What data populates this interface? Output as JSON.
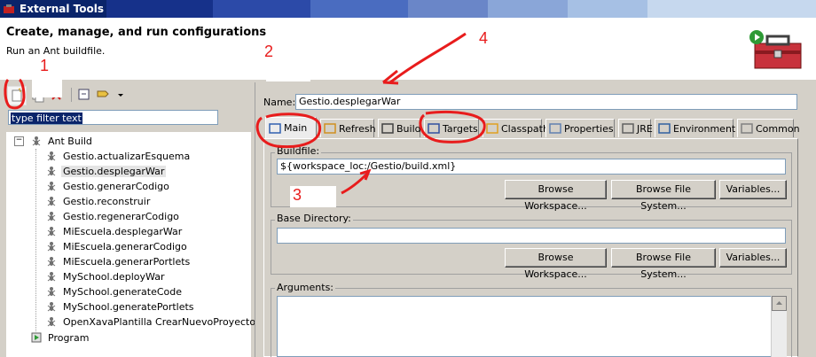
{
  "window": {
    "title": "External Tools",
    "title_gradient": [
      "#0a246a",
      "#16318a",
      "#2c4aa8",
      "#4a6cc0",
      "#6a86c8",
      "#8aa6d8",
      "#a6c0e4",
      "#c6d8ee"
    ]
  },
  "header": {
    "title": "Create, manage, and run configurations",
    "subtitle": "Run an Ant buildfile."
  },
  "left": {
    "filter_placeholder": "type filter text",
    "tree": {
      "root_label": "Ant Build",
      "items": [
        "Gestio.actualizarEsquema",
        "Gestio.desplegarWar",
        "Gestio.generarCodigo",
        "Gestio.reconstruir",
        "Gestio.regenerarCodigo",
        "MiEscuela.desplegarWar",
        "MiEscuela.generarCodigo",
        "MiEscuela.generarPortlets",
        "MySchool.deployWar",
        "MySchool.generateCode",
        "MySchool.generatePortlets",
        "OpenXavaPlantilla CrearNuevoProyecto.xm"
      ],
      "selected_index": 1,
      "program_label": "Program"
    }
  },
  "right": {
    "name_label": "Name:",
    "name_value": "Gestio.desplegarWar",
    "tabs": [
      "Main",
      "Refresh",
      "Build",
      "Targets",
      "Classpath",
      "Properties",
      "JRE",
      "Environment",
      "Common"
    ],
    "active_tab": "Main",
    "buildfile": {
      "label": "Buildfile:",
      "value": "${workspace_loc:/Gestio/build.xml}",
      "buttons": [
        "Browse Workspace...",
        "Browse File System...",
        "Variables..."
      ]
    },
    "base_directory": {
      "label": "Base Directory:",
      "value": "",
      "buttons": [
        "Browse Workspace...",
        "Browse File System...",
        "Variables..."
      ]
    },
    "arguments": {
      "label": "Arguments:"
    }
  },
  "annotations": [
    "1",
    "2",
    "3",
    "4"
  ],
  "colors": {
    "annotation": "#e81c1c",
    "selection": "#0a246a"
  }
}
